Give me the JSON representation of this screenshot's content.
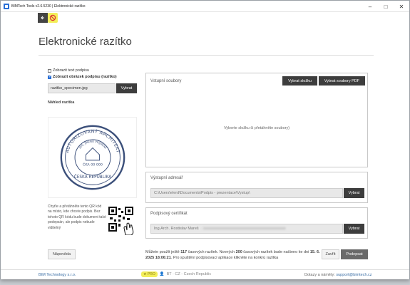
{
  "window": {
    "title": "BIMTech Tools v2.6.5230 | Elektronické razítko"
  },
  "page": {
    "heading": "Elektronické razítko"
  },
  "left": {
    "show_text_label": "Zobrazit text podpisu",
    "show_text_checked": false,
    "show_image_label": "Zobrazit obrázek podpisu (razítko)",
    "show_image_checked": true,
    "image_file": "razitko_specimen.jpg",
    "choose_button": "Vybrat",
    "preview_label": "Náhled razítka",
    "qr_hint": "Chyťte a přetáhněte tento QR kód na místo, kde chcete podpis. Bez tohoto QR kódu bude dokument také podepsán, ale podpis nebude viditelný",
    "help_button": "Nápověda"
  },
  "stamp": {
    "ring_top": "AUTORIZOVANÝ ARCHITEKT",
    "ring_inner": "ING. JMÉNO PŘÍJMENÍ",
    "center_line1": "ČKA 00 000",
    "center_line2": "ČESKÁ REPUBLIKA"
  },
  "inputs_panel": {
    "title": "Vstupní soubory",
    "choose_folder": "Vybrat složku",
    "choose_pdf": "Vybrat soubory PDF",
    "placeholder": "Vyberte složku či přetáhněte soubory)"
  },
  "output_panel": {
    "title": "Výstupní adresář",
    "path": "C:\\Users\\elerd\\Documents\\Podpis - prezentace\\Vystup\\",
    "button": "Vybrat"
  },
  "cert_panel": {
    "title": "Podpisový certifikát",
    "value": "Ing.Arch. Rostislav Mareš",
    "value_blurred": "- xxxxxxxxxxxxxxxxxxxxxxxxxxxxxxxxxxxxxxxxxx",
    "button": "Vybrat"
  },
  "bottom": {
    "note_part1": "Můžete použít ještě ",
    "remaining": "117",
    "note_part2": " časových razítek. Novných ",
    "new_count": "200",
    "note_part3": " časových razítek bude načteno ke dni ",
    "reload_date": "15. 6. 2025 18:06:21",
    "note_part4": ". Pro spuštění podpisovací aplikace klikněte na konkrú razítka",
    "close_button": "Zavřít",
    "sign_button": "Podepsat"
  },
  "statusbar": {
    "company": "BIM Technology s.r.o.",
    "pro_badge": "PRO",
    "lang": "BT · CZ - Czech Republic",
    "contact_label": "Dotazy a náměty:",
    "contact_email": "support@bimtech.cz"
  },
  "colors": {
    "accent_blue": "#2a6fd6",
    "dark_button": "#3d3d3d",
    "pro_yellow": "#f3ee5a"
  }
}
